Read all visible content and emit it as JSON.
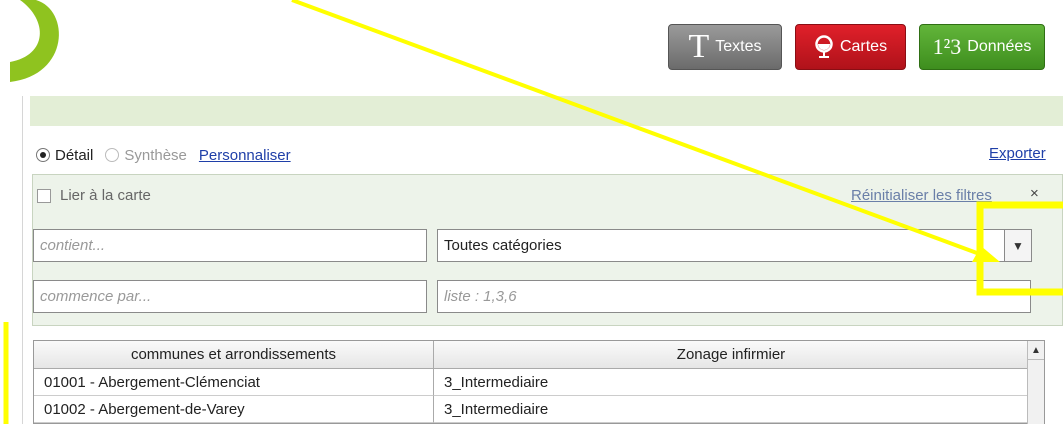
{
  "buttons": {
    "textes": {
      "glyph": "T",
      "label": "Textes"
    },
    "cartes": {
      "label": "Cartes"
    },
    "donnees": {
      "glyph": "1²3",
      "label": "Données"
    }
  },
  "mode": {
    "detail_label": "Détail",
    "synthese_label": "Synthèse",
    "personnaliser_label": "Personnaliser",
    "exporter_label": "Exporter",
    "selected": "Détail"
  },
  "filters": {
    "lier_label": "Lier à la carte",
    "lier_checked": false,
    "reinit_label": "Réinitialiser les filtres",
    "close_glyph": "×",
    "contient_placeholder": "contient...",
    "category_value": "Toutes catégories",
    "commence_placeholder": "commence par...",
    "liste_placeholder": "liste : 1,3,6"
  },
  "table": {
    "columns": [
      "communes et arrondissements",
      "Zonage infirmier"
    ],
    "rows": [
      [
        "01001 - Abergement-Clémenciat",
        "3_Intermediaire"
      ],
      [
        "01002 - Abergement-de-Varey",
        "3_Intermediaire"
      ]
    ]
  },
  "colors": {
    "textes": "#7d7d7d",
    "cartes": "#c8181f",
    "donnees": "#4fa02a",
    "annotation": "#ffff00",
    "logo": "#8fc31f"
  }
}
